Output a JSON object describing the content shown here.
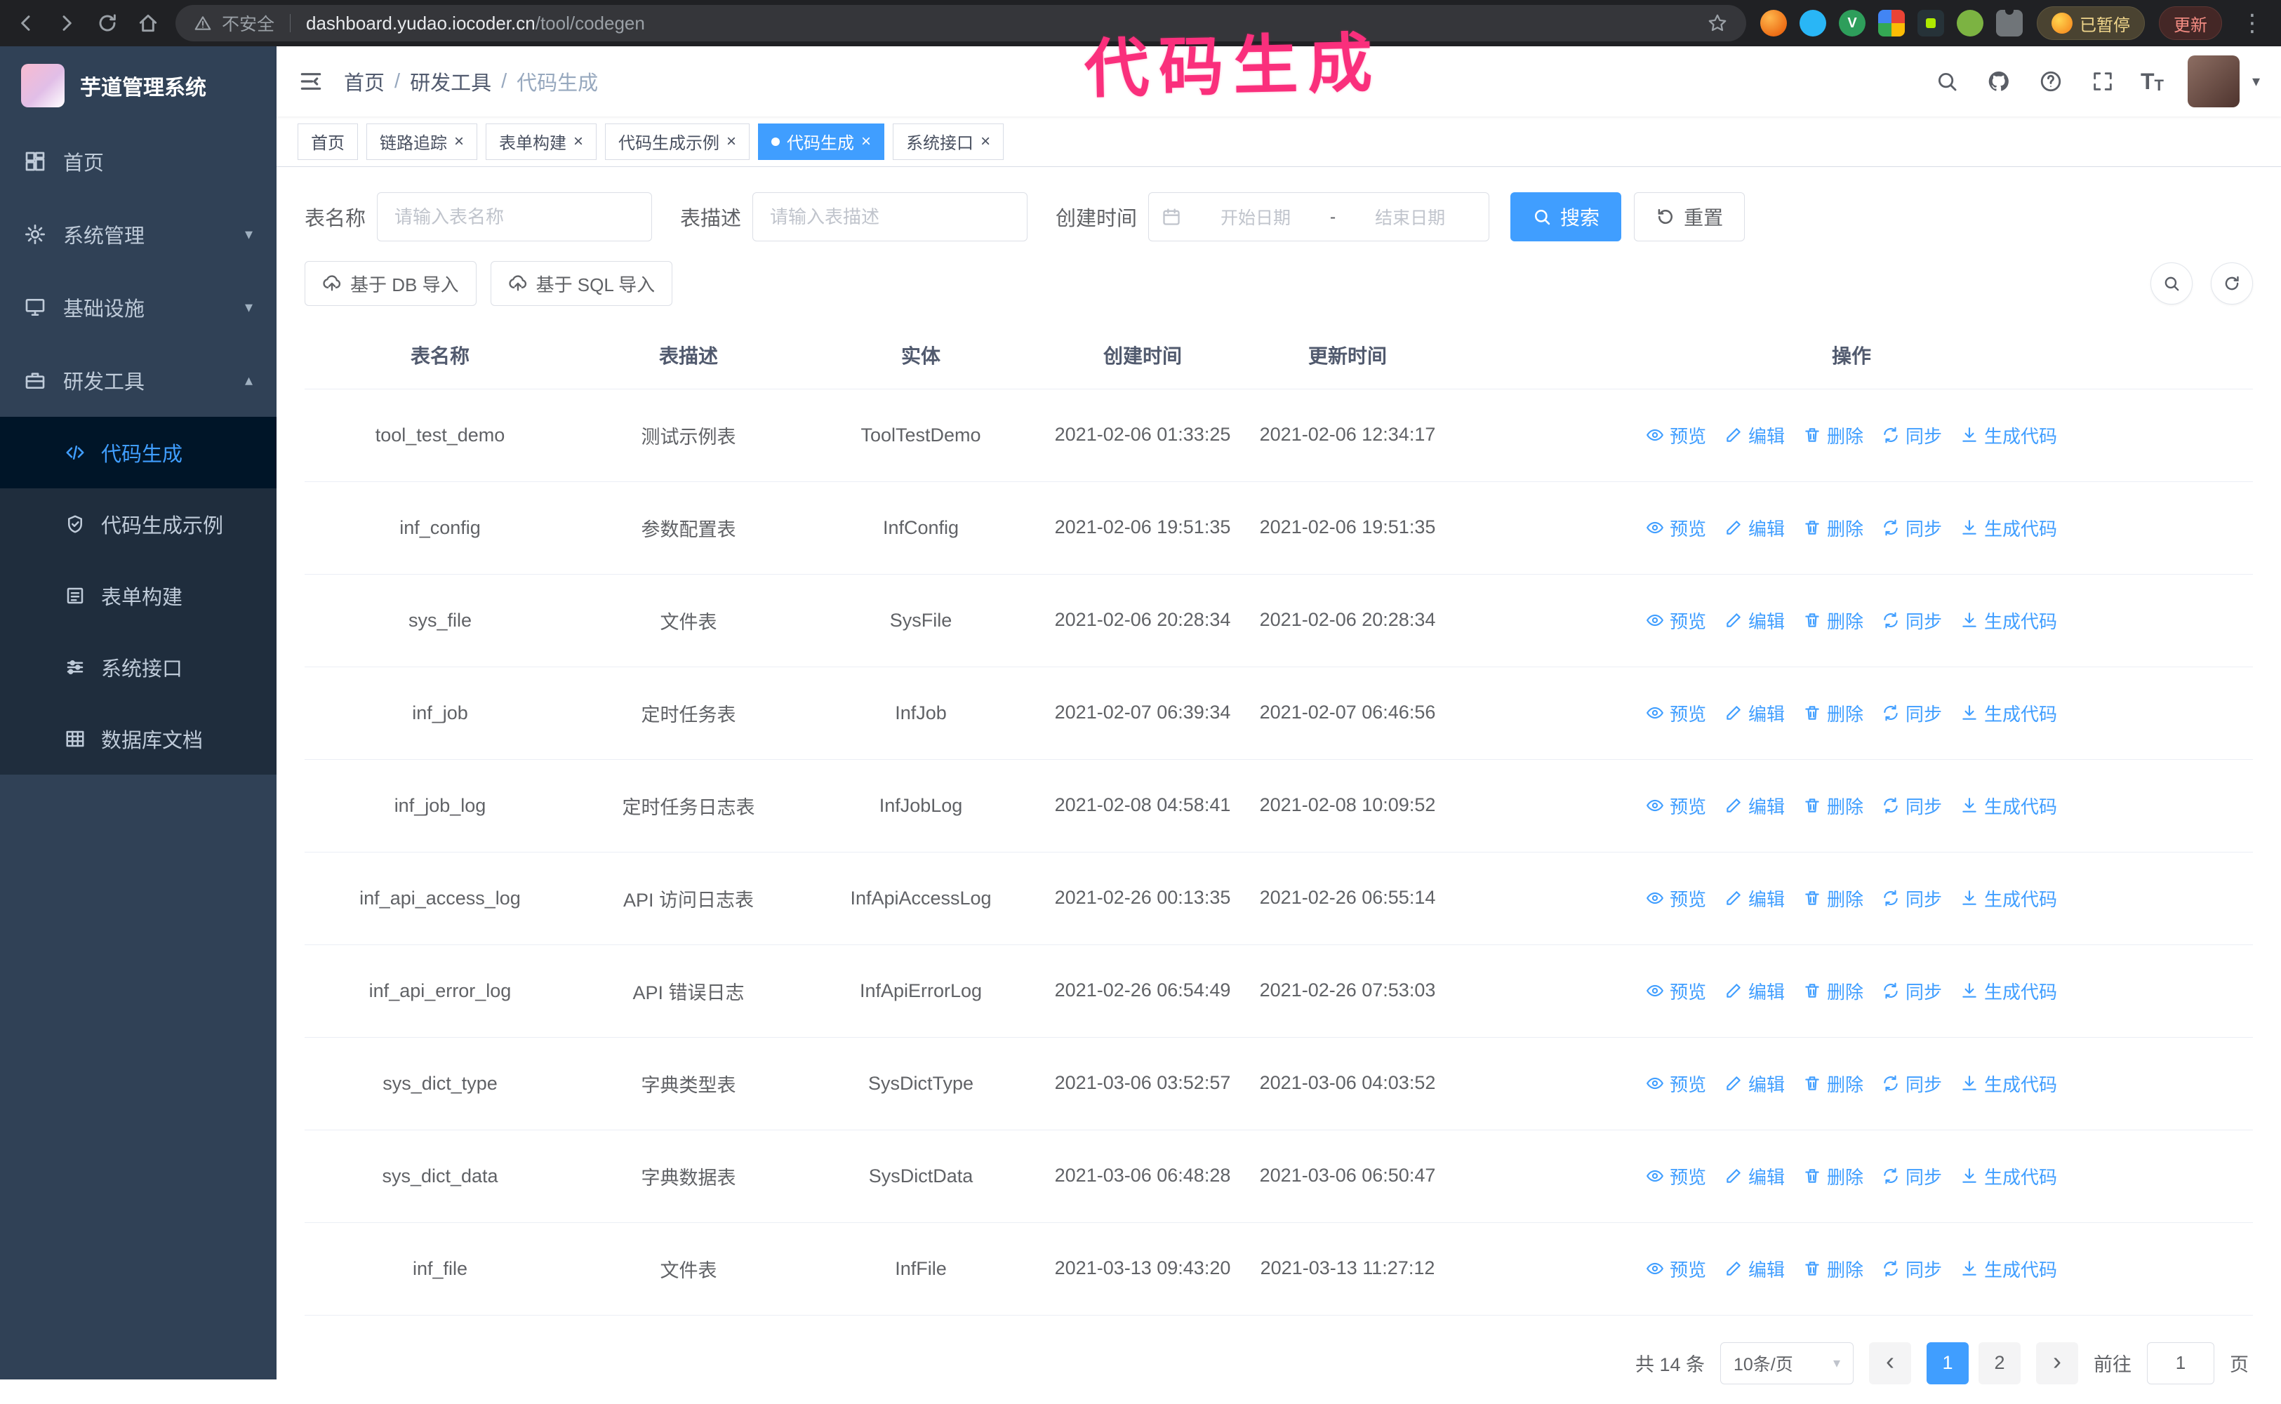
{
  "browser": {
    "security_warning": "不安全",
    "url_domain": "dashboard.yudao.iocoder.cn",
    "url_path": "/tool/codegen",
    "paused_badge": "已暂停",
    "update_button": "更新"
  },
  "annotation": {
    "text": "代码生成",
    "color": "#fa2f7c"
  },
  "sidebar": {
    "logo_title": "芋道管理系统",
    "items": [
      {
        "label": "首页",
        "icon": "home-icon",
        "expandable": false,
        "open": false
      },
      {
        "label": "系统管理",
        "icon": "gear-icon",
        "expandable": true,
        "open": false
      },
      {
        "label": "基础设施",
        "icon": "infra-icon",
        "expandable": true,
        "open": false
      },
      {
        "label": "研发工具",
        "icon": "tools-icon",
        "expandable": true,
        "open": true
      }
    ],
    "sub_items": [
      {
        "label": "代码生成",
        "icon": "code-icon",
        "active": true
      },
      {
        "label": "代码生成示例",
        "icon": "example-icon",
        "active": false
      },
      {
        "label": "表单构建",
        "icon": "form-icon",
        "active": false
      },
      {
        "label": "系统接口",
        "icon": "api-icon",
        "active": false
      },
      {
        "label": "数据库文档",
        "icon": "dbdoc-icon",
        "active": false
      }
    ]
  },
  "navbar": {
    "breadcrumb": [
      "首页",
      "研发工具",
      "代码生成"
    ]
  },
  "tabs": [
    {
      "label": "首页",
      "closable": false,
      "active": false
    },
    {
      "label": "链路追踪",
      "closable": true,
      "active": false
    },
    {
      "label": "表单构建",
      "closable": true,
      "active": false
    },
    {
      "label": "代码生成示例",
      "closable": true,
      "active": false
    },
    {
      "label": "代码生成",
      "closable": true,
      "active": true
    },
    {
      "label": "系统接口",
      "closable": true,
      "active": false
    }
  ],
  "filters": {
    "table_name_label": "表名称",
    "table_name_placeholder": "请输入表名称",
    "table_desc_label": "表描述",
    "table_desc_placeholder": "请输入表描述",
    "create_time_label": "创建时间",
    "start_date_placeholder": "开始日期",
    "date_separator": "-",
    "end_date_placeholder": "结束日期",
    "search_button": "搜索",
    "reset_button": "重置"
  },
  "toolbar": {
    "import_db_label": "基于 DB 导入",
    "import_sql_label": "基于 SQL 导入"
  },
  "table": {
    "columns": [
      "表名称",
      "表描述",
      "实体",
      "创建时间",
      "更新时间",
      "操作"
    ],
    "action_labels": [
      "预览",
      "编辑",
      "删除",
      "同步",
      "生成代码"
    ],
    "rows": [
      {
        "name": "tool_test_demo",
        "desc": "测试示例表",
        "entity": "ToolTestDemo",
        "created": "2021-02-06 01:33:25",
        "updated": "2021-02-06 12:34:17"
      },
      {
        "name": "inf_config",
        "desc": "参数配置表",
        "entity": "InfConfig",
        "created": "2021-02-06 19:51:35",
        "updated": "2021-02-06 19:51:35"
      },
      {
        "name": "sys_file",
        "desc": "文件表",
        "entity": "SysFile",
        "created": "2021-02-06 20:28:34",
        "updated": "2021-02-06 20:28:34"
      },
      {
        "name": "inf_job",
        "desc": "定时任务表",
        "entity": "InfJob",
        "created": "2021-02-07 06:39:34",
        "updated": "2021-02-07 06:46:56"
      },
      {
        "name": "inf_job_log",
        "desc": "定时任务日志表",
        "entity": "InfJobLog",
        "created": "2021-02-08 04:58:41",
        "updated": "2021-02-08 10:09:52"
      },
      {
        "name": "inf_api_access_log",
        "desc": "API 访问日志表",
        "entity": "InfApiAccessLog",
        "created": "2021-02-26 00:13:35",
        "updated": "2021-02-26 06:55:14"
      },
      {
        "name": "inf_api_error_log",
        "desc": "API 错误日志",
        "entity": "InfApiErrorLog",
        "created": "2021-02-26 06:54:49",
        "updated": "2021-02-26 07:53:03"
      },
      {
        "name": "sys_dict_type",
        "desc": "字典类型表",
        "entity": "SysDictType",
        "created": "2021-03-06 03:52:57",
        "updated": "2021-03-06 04:03:52"
      },
      {
        "name": "sys_dict_data",
        "desc": "字典数据表",
        "entity": "SysDictData",
        "created": "2021-03-06 06:48:28",
        "updated": "2021-03-06 06:50:47"
      },
      {
        "name": "inf_file",
        "desc": "文件表",
        "entity": "InfFile",
        "created": "2021-03-13 09:43:20",
        "updated": "2021-03-13 11:27:12"
      }
    ]
  },
  "pagination": {
    "total_text": "共 14 条",
    "page_size": "10条/页",
    "pages": [
      "1",
      "2"
    ],
    "active_page": "1",
    "goto_label": "前往",
    "goto_value": "1",
    "unit_label": "页"
  },
  "colors": {
    "accent": "#409EFF",
    "sidebar_bg": "#304156",
    "submenu_bg": "#1f2d3d",
    "active_item_bg": "#001528"
  }
}
